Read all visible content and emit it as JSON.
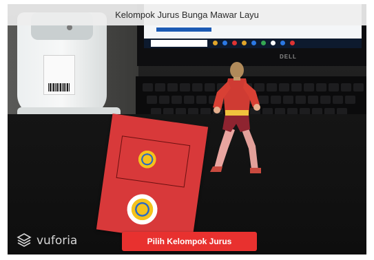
{
  "header": {
    "title": "Kelompok Jurus Bunga Mawar Layu"
  },
  "footer": {
    "brand_logo": "vuforia",
    "action_button_label": "Pilih Kelompok Jurus"
  },
  "colors": {
    "accent_button": "#e8312f",
    "title_bar_bg": "#eeeeee"
  },
  "icons": [
    "vuforia-logo-icon"
  ]
}
